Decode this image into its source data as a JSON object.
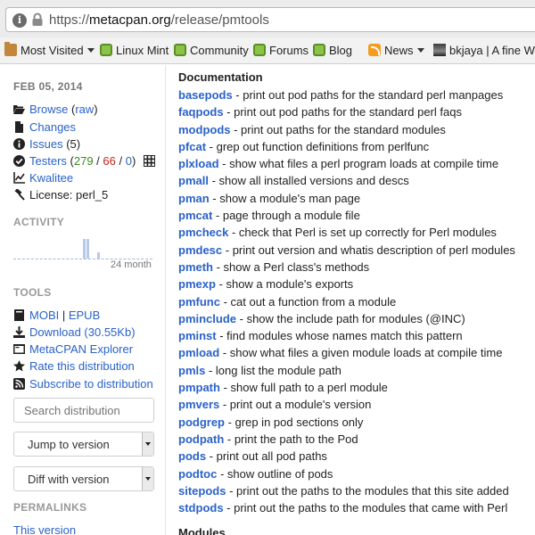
{
  "browser": {
    "url_prefix": "https://",
    "url_host": "metacpan.org",
    "url_path": "/release/pmtools",
    "bookmarks": [
      {
        "label": "Most Visited",
        "icon": "folder-icon",
        "dropdown": true
      },
      {
        "label": "Linux Mint",
        "icon": "mint-icon",
        "dropdown": false
      },
      {
        "label": "Community",
        "icon": "mint-icon",
        "dropdown": false
      },
      {
        "label": "Forums",
        "icon": "mint-icon",
        "dropdown": false
      },
      {
        "label": "Blog",
        "icon": "mint-icon",
        "dropdown": false
      },
      {
        "label": "News",
        "icon": "rss-icon",
        "dropdown": true
      },
      {
        "label": "bkjaya | A fine Wo",
        "icon": "page-image-icon",
        "dropdown": false
      }
    ]
  },
  "sidebar": {
    "date": "FEB 05, 2014",
    "browse_label": "Browse",
    "browse_raw_open": " (",
    "browse_raw": "raw",
    "browse_raw_close": ")",
    "changes": "Changes",
    "issues": "Issues",
    "issues_count": " (5)",
    "testers": "Testers",
    "testers_open": " (",
    "testers_pass": "279",
    "testers_sep1": " / ",
    "testers_fail": "66",
    "testers_sep2": " / ",
    "testers_na": "0",
    "testers_close": ")",
    "kwalitee": "Kwalitee",
    "license": "License: perl_5",
    "activity_title": "ACTIVITY",
    "activity_label": "24 month",
    "activity_values": [
      0,
      0,
      0,
      0,
      0,
      0,
      0,
      0,
      0,
      0,
      0,
      0,
      0,
      0,
      0,
      0,
      0,
      0,
      0,
      0,
      1,
      1,
      0,
      0,
      0.3,
      0,
      0,
      0,
      0,
      0,
      0,
      0,
      0,
      0,
      0,
      0,
      0,
      0,
      0,
      0
    ],
    "tools_title": "TOOLS",
    "mobi": "MOBI",
    "tools_sep": " | ",
    "epub": "EPUB",
    "download": "Download (30.55Kb)",
    "explorer": "MetaCPAN Explorer",
    "rate": "Rate this distribution",
    "subscribe": "Subscribe to distribution",
    "search_placeholder": "Search distribution",
    "jump_label": "Jump to version",
    "diff_label": "Diff with version",
    "permalinks_title": "PERMALINKS",
    "this_version": "This version"
  },
  "content": {
    "documentation_title": "Documentation",
    "modules_title": "Modules",
    "docs": [
      {
        "name": "basepods",
        "desc": " - print out pod paths for the standard perl manpages"
      },
      {
        "name": "faqpods",
        "desc": " - print out pod paths for the standard perl faqs"
      },
      {
        "name": "modpods",
        "desc": " - print out paths for the standard modules"
      },
      {
        "name": "pfcat",
        "desc": " - grep out function definitions from perlfunc"
      },
      {
        "name": "plxload",
        "desc": " - show what files a perl program loads at compile time"
      },
      {
        "name": "pmall",
        "desc": " - show all installed versions and descs"
      },
      {
        "name": "pman",
        "desc": " - show a module's man page"
      },
      {
        "name": "pmcat",
        "desc": " - page through a module file"
      },
      {
        "name": "pmcheck",
        "desc": " - check that Perl is set up correctly for Perl modules"
      },
      {
        "name": "pmdesc",
        "desc": " - print out version and whatis description of perl modules"
      },
      {
        "name": "pmeth",
        "desc": " - show a Perl class's methods"
      },
      {
        "name": "pmexp",
        "desc": " - show a module's exports"
      },
      {
        "name": "pmfunc",
        "desc": " - cat out a function from a module"
      },
      {
        "name": "pminclude",
        "desc": " - show the include path for modules (@INC)"
      },
      {
        "name": "pminst",
        "desc": " - find modules whose names match this pattern"
      },
      {
        "name": "pmload",
        "desc": " - show what files a given module loads at compile time"
      },
      {
        "name": "pmls",
        "desc": " - long list the module path"
      },
      {
        "name": "pmpath",
        "desc": " - show full path to a perl module"
      },
      {
        "name": "pmvers",
        "desc": " - print out a module's version"
      },
      {
        "name": "podgrep",
        "desc": " - grep in pod sections only"
      },
      {
        "name": "podpath",
        "desc": " - print the path to the Pod"
      },
      {
        "name": "pods",
        "desc": " - print out all pod paths"
      },
      {
        "name": "podtoc",
        "desc": " - show outline of pods"
      },
      {
        "name": "sitepods",
        "desc": " - print out the paths to the modules that this site added"
      },
      {
        "name": "stdpods",
        "desc": " - print out the paths to the modules that came with Perl"
      }
    ]
  }
}
